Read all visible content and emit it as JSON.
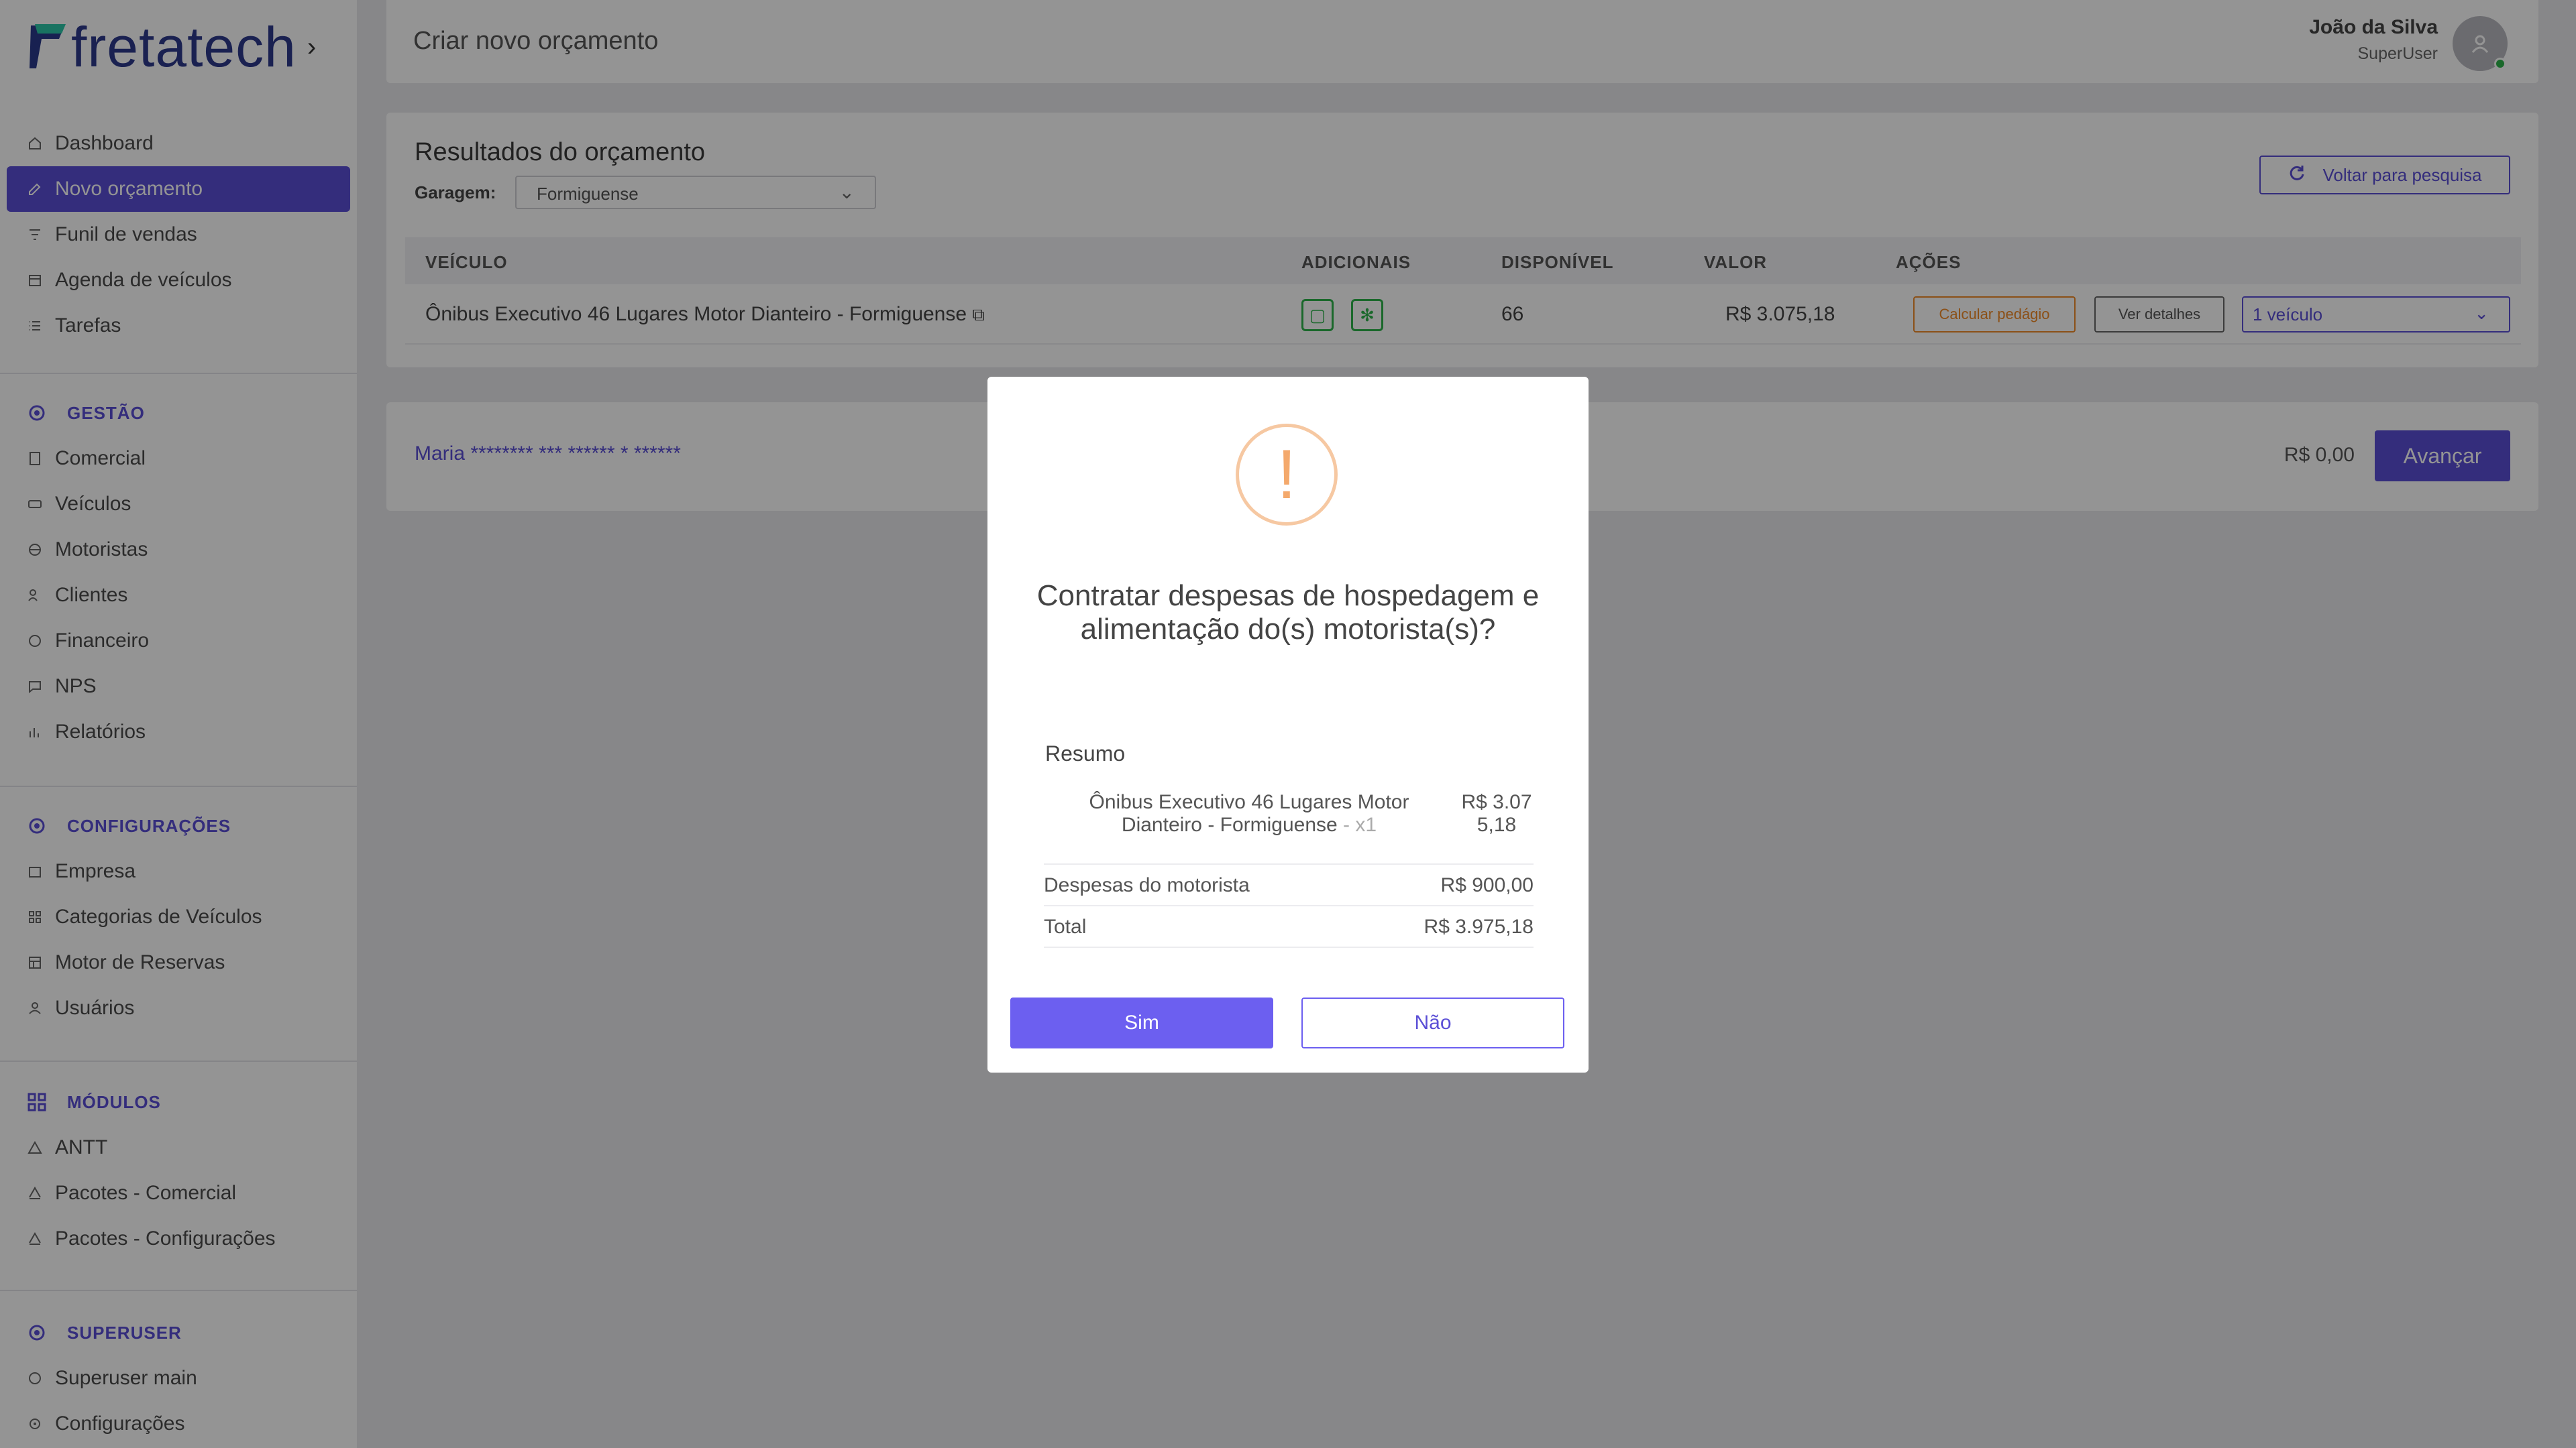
{
  "brand": {
    "logo_text_a": "fretatech",
    "accent": "#5b4fd6"
  },
  "sidebar": {
    "main_items": [
      {
        "label": "Dashboard",
        "icon": "home-icon"
      },
      {
        "label": "Novo orçamento",
        "icon": "edit-icon",
        "active": true
      },
      {
        "label": "Funil de vendas",
        "icon": "funnel-icon"
      },
      {
        "label": "Agenda de veículos",
        "icon": "calendar-icon"
      },
      {
        "label": "Tarefas",
        "icon": "list-icon"
      }
    ],
    "sections": [
      {
        "title": "GESTÃO",
        "items": [
          "Comercial",
          "Veículos",
          "Motoristas",
          "Clientes",
          "Financeiro",
          "NPS",
          "Relatórios"
        ]
      },
      {
        "title": "CONFIGURAÇÕES",
        "items": [
          "Empresa",
          "Categorias de Veículos",
          "Motor de Reservas",
          "Usuários"
        ]
      },
      {
        "title": "MÓDULOS",
        "items": [
          "ANTT",
          "Pacotes - Comercial",
          "Pacotes - Configurações"
        ]
      },
      {
        "title": "SUPERUSER",
        "items": [
          "Superuser main",
          "Configurações"
        ]
      }
    ]
  },
  "header": {
    "title": "Criar novo orçamento",
    "user_name": "João da Silva",
    "user_role": "SuperUser"
  },
  "results": {
    "title": "Resultados do orçamento",
    "garage_label": "Garagem:",
    "garage_value": "Formiguense",
    "back_button": "Voltar para pesquisa",
    "columns": [
      "VEÍCULO",
      "ADICIONAIS",
      "DISPONÍVEL",
      "VALOR",
      "AÇÕES"
    ],
    "row": {
      "vehicle": "Ônibus Executivo 46 Lugares Motor Dianteiro - Formiguense",
      "available": "66",
      "value": "R$ 3.075,18",
      "toll_button": "Calcular pedágio",
      "details_button": "Ver detalhes",
      "vehicles_select": "1 veículo"
    }
  },
  "footer": {
    "client": "Maria ******** *** ****** * ******",
    "total": "R$ 0,00",
    "next_button": "Avançar"
  },
  "modal": {
    "title": "Contratar despesas de hospedagem e alimentação do(s) motorista(s)?",
    "summary_title": "Resumo",
    "item_name": "Ônibus Executivo 46 Lugares Motor Dianteiro - Formiguense",
    "item_qty": " - x1",
    "item_price": "R$ 3.075,18",
    "driver_label": "Despesas do motorista",
    "driver_value": "R$ 900,00",
    "total_label": "Total",
    "total_value": "R$ 3.975,18",
    "yes": "Sim",
    "no": "Não"
  }
}
